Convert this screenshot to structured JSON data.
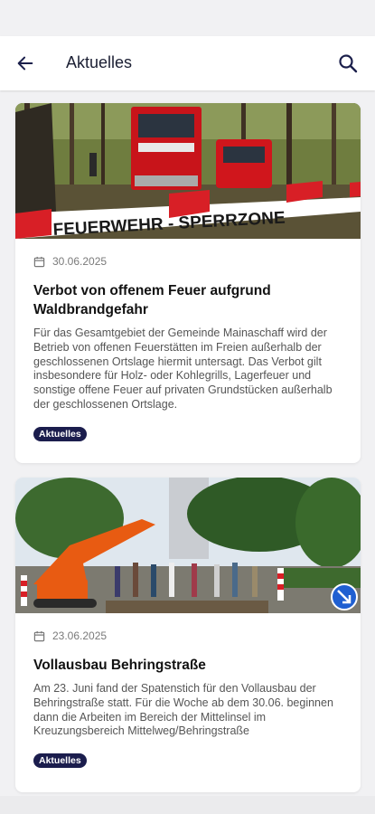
{
  "header": {
    "title": "Aktuelles"
  },
  "articles": [
    {
      "date": "30.06.2025",
      "title": "Verbot von offenem Feuer aufgrund Waldbrandgefahr",
      "text": "Für das Gesamtgebiet der Gemeinde Mainaschaff wird der Betrieb von offenen Feuerstätten im Freien außerhalb der geschlossenen Ortslage hiermit untersagt. Das Verbot gilt insbesondere für Holz- oder Kohlegrills, Lagerfeuer und sonstige offene Feuer auf privaten Grundstücken außerhalb der geschlossenen Ortslage.",
      "badge": "Aktuelles",
      "image_tape_text": "FEUERWEHR - SPERRZONE"
    },
    {
      "date": "23.06.2025",
      "title": "Vollausbau Behringstraße",
      "text": "Am 23. Juni fand der Spatenstich für den Vollausbau der Behringstraße statt. Für die Woche ab dem 30.06. beginnen dann die Arbeiten im Bereich der Mittelinsel im Kreuzungsbereich Mittelweg/Behringstraße",
      "badge": "Aktuelles"
    }
  ],
  "colors": {
    "badge": "#1b1d4d",
    "appbar": "#ffffff",
    "background": "#f1f1f3"
  }
}
